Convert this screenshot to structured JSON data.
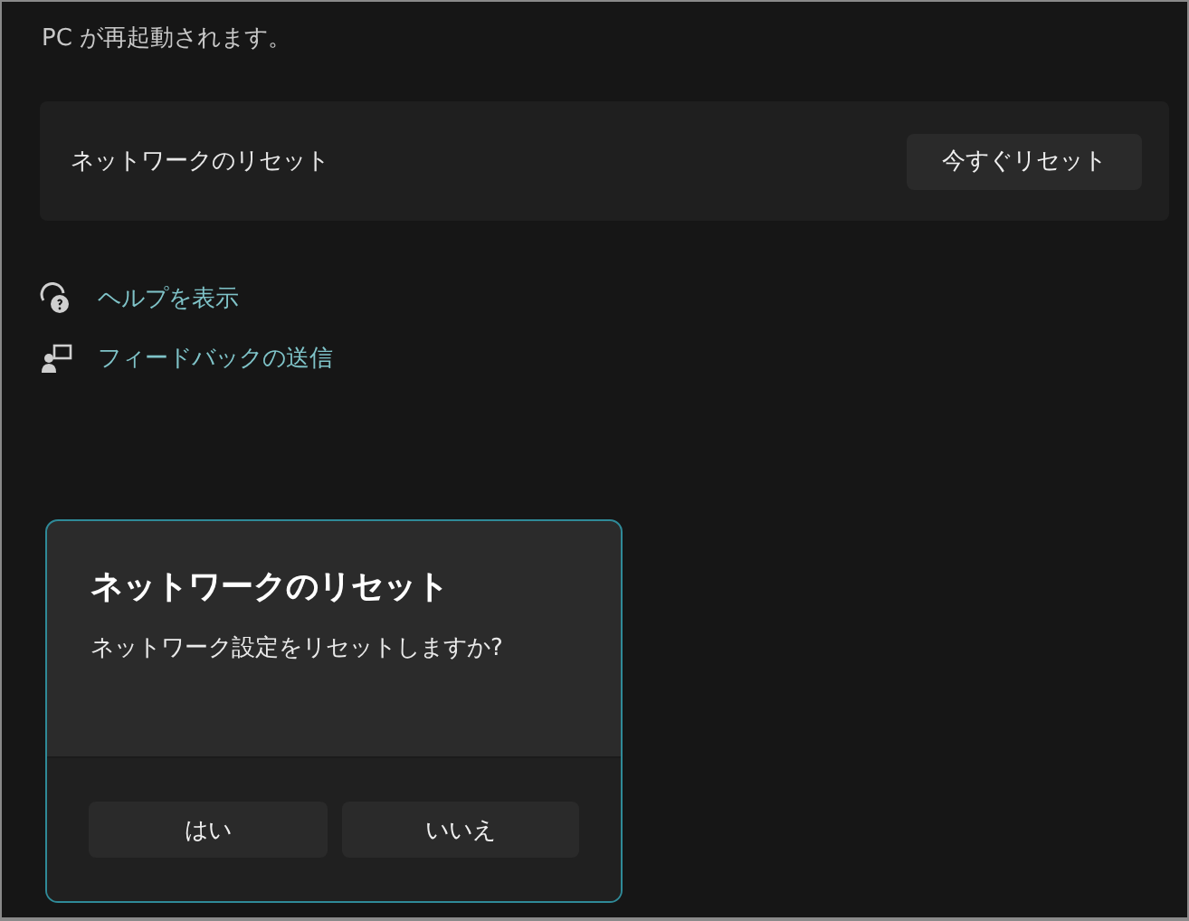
{
  "notice": "PC が再起動されます。",
  "reset_card": {
    "label": "ネットワークのリセット",
    "button": "今すぐリセット"
  },
  "links": [
    {
      "kind": "help",
      "label": "ヘルプを表示"
    },
    {
      "kind": "feedback",
      "label": "フィードバックの送信"
    }
  ],
  "dialog": {
    "title": "ネットワークのリセット",
    "message": "ネットワーク設定をリセットしますか?",
    "buttons": [
      "はい",
      "いいえ"
    ]
  }
}
